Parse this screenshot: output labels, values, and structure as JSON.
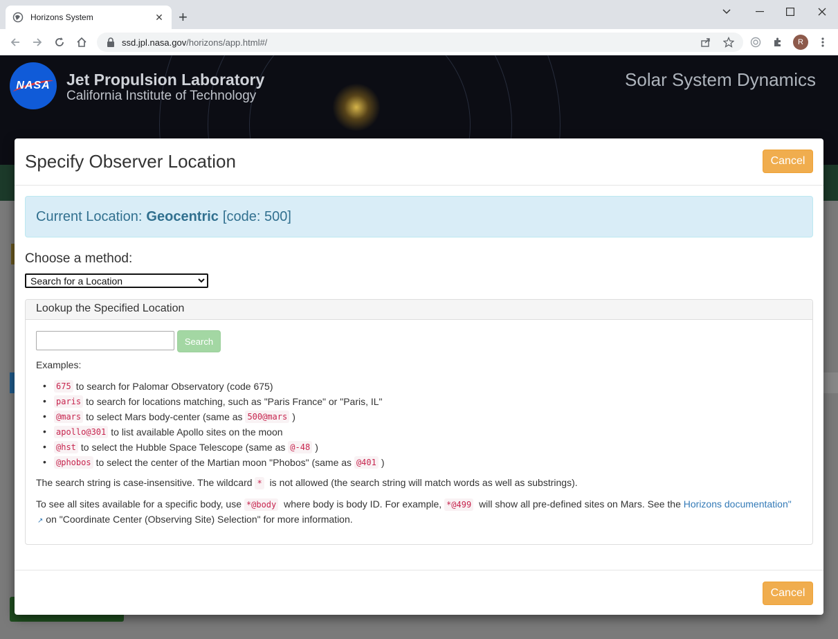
{
  "browser": {
    "tab_title": "Horizons System",
    "tab_close": "✕",
    "new_tab": "+",
    "url_host": "ssd.jpl.nasa.gov",
    "url_path": "/horizons/app.html#/",
    "profile_initial": "R"
  },
  "banner": {
    "logo_text": "NASA",
    "org_title": "Jet Propulsion Laboratory",
    "org_subtitle": "California Institute of Technology",
    "site_title": "Solar System Dynamics"
  },
  "modal": {
    "title": "Specify Observer Location",
    "cancel_label": "Cancel",
    "current_location": {
      "label": "Current Location:",
      "name": "Geocentric",
      "code": "[code: 500]"
    },
    "choose_label": "Choose a method:",
    "method_selected": "Search for a Location",
    "panel": {
      "heading": "Lookup the Specified Location",
      "search_value": "",
      "search_label": "Search",
      "examples_label": "Examples:",
      "examples": [
        {
          "code": "675",
          "text": "to search for Palomar Observatory (code 675)",
          "code2": "",
          "tail": ""
        },
        {
          "code": "paris",
          "text": "to search for locations matching, such as \"Paris France\" or \"Paris, IL\"",
          "code2": "",
          "tail": ""
        },
        {
          "code": "@mars",
          "text": "to select Mars body-center (same as",
          "code2": "500@mars",
          "tail": ")"
        },
        {
          "code": "apollo@301",
          "text": "to list available Apollo sites on the moon",
          "code2": "",
          "tail": ""
        },
        {
          "code": "@hst",
          "text": "to select the Hubble Space Telescope (same as",
          "code2": "@-48",
          "tail": ")"
        },
        {
          "code": "@phobos",
          "text": "to select the center of the Martian moon \"Phobos\" (same as",
          "code2": "@401",
          "tail": ")"
        }
      ],
      "note1_a": "The search string is case-insensitive. The wildcard",
      "note1_code": "*",
      "note1_b": "is not allowed (the search string will match words as well as substrings).",
      "note2_a": "To see all sites available for a specific body, use",
      "note2_code1": "*@body",
      "note2_b": "where body is body ID. For example,",
      "note2_code2": "*@499",
      "note2_c": "will show all pre-defined sites on Mars. See the",
      "note2_link": "Horizons documentation\"",
      "note2_d": "on \"Coordinate Center (Observing Site) Selection\" for more information."
    }
  }
}
